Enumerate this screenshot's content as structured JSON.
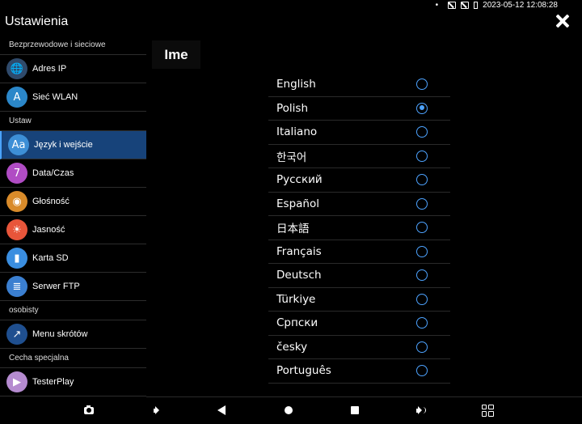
{
  "status_bar": {
    "datetime": "2023-05-12 12:08:28",
    "dot": "•"
  },
  "header": {
    "title": "Ustawienia"
  },
  "sidebar": {
    "sections": [
      {
        "header": "Bezprzewodowe i sieciowe",
        "items": [
          {
            "label": "Adres IP",
            "icon": "globe-icon",
            "glyph": "🌐",
            "color": "#2f4a6b"
          },
          {
            "label": "Sieć WLAN",
            "icon": "wlan-antenna-icon",
            "glyph": "A",
            "color": "#2b87c9"
          }
        ]
      },
      {
        "header": "Ustaw",
        "items": [
          {
            "label": "Język i wejście",
            "icon": "language-icon",
            "glyph": "Aa",
            "color": "#3d8fd6",
            "active": true
          },
          {
            "label": "Data/Czas",
            "icon": "calendar-icon",
            "glyph": "7",
            "color": "#b04cc4"
          },
          {
            "label": "Głośność",
            "icon": "speaker-icon",
            "glyph": "◉",
            "color": "#d98b2a"
          },
          {
            "label": "Jasność",
            "icon": "lightbulb-icon",
            "glyph": "☀",
            "color": "#e8553a"
          },
          {
            "label": "Karta SD",
            "icon": "sd-card-icon",
            "glyph": "▮",
            "color": "#3a8ee0"
          },
          {
            "label": "Serwer FTP",
            "icon": "ftp-server-icon",
            "glyph": "≣",
            "color": "#3b7fd0"
          }
        ]
      },
      {
        "header": "osobisty",
        "items": [
          {
            "label": "Menu skrótów",
            "icon": "shortcut-menu-icon",
            "glyph": "↗",
            "color": "#1f4f8f"
          }
        ]
      },
      {
        "header": "Cecha specjalna",
        "items": [
          {
            "label": "TesterPlay",
            "icon": "testerplay-icon",
            "glyph": "▶",
            "color": "#b58bd0"
          }
        ]
      }
    ]
  },
  "content": {
    "title": "Ime",
    "languages": [
      {
        "label": "English",
        "selected": false
      },
      {
        "label": "Polish",
        "selected": true
      },
      {
        "label": "Italiano",
        "selected": false
      },
      {
        "label": "한국어",
        "selected": false
      },
      {
        "label": "Русский",
        "selected": false
      },
      {
        "label": "Español",
        "selected": false
      },
      {
        "label": "日本語",
        "selected": false
      },
      {
        "label": "Français",
        "selected": false
      },
      {
        "label": "Deutsch",
        "selected": false
      },
      {
        "label": "Türkiye",
        "selected": false
      },
      {
        "label": "Српски",
        "selected": false
      },
      {
        "label": "česky",
        "selected": false
      },
      {
        "label": "Português",
        "selected": false
      }
    ]
  },
  "navbar": {
    "buttons": [
      "camera-icon",
      "volume-down-icon",
      "back-icon",
      "home-icon",
      "recents-icon",
      "volume-up-icon",
      "app-grid-icon"
    ]
  },
  "colors": {
    "accent": "#4da3ff",
    "active_item_bg": "#17437a",
    "background": "#000000"
  }
}
